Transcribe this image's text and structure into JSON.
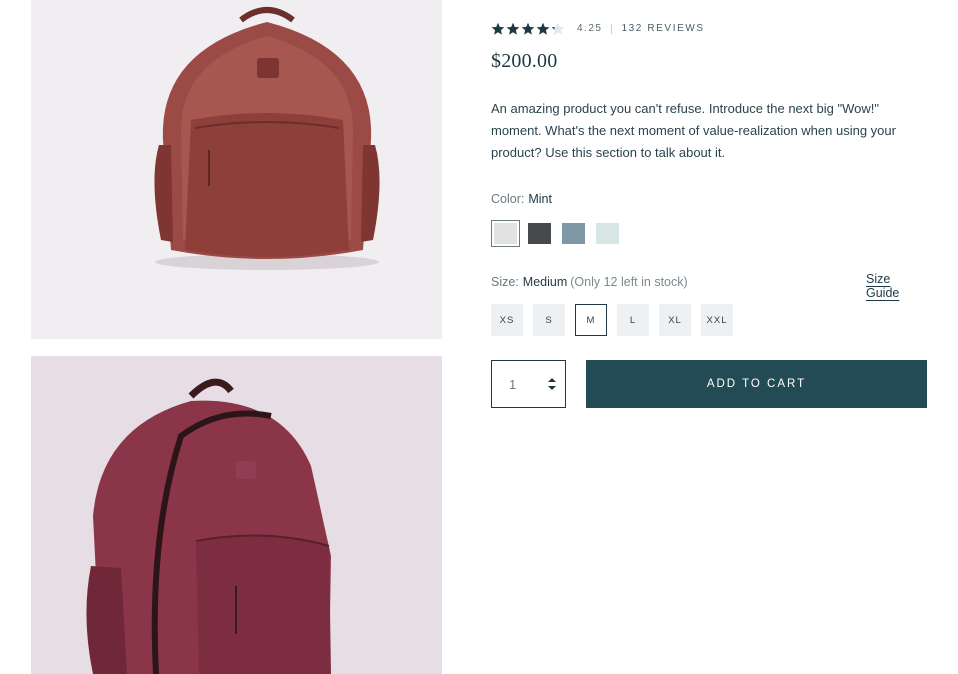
{
  "gallery": {
    "images": [
      {
        "name": "product-image-front",
        "alt": "Red leather backpack front view"
      },
      {
        "name": "product-image-angle",
        "alt": "Red leather backpack angled view"
      }
    ]
  },
  "product": {
    "rating": 4.25,
    "rating_text": "4.25",
    "review_count_text": "132 REVIEWS",
    "price": "$200.00",
    "description": "An amazing product you can't refuse. Introduce the next big \"Wow!\" moment. What's the next moment of value-realization when using your product? Use this section to talk about it."
  },
  "color": {
    "label": "Color:",
    "selected": "Mint",
    "swatches": [
      {
        "name": "light-gray",
        "hex": "#e2e2e2",
        "selected": true
      },
      {
        "name": "charcoal",
        "hex": "#474a4c",
        "selected": false
      },
      {
        "name": "slate-blue",
        "hex": "#7e98a6",
        "selected": false
      },
      {
        "name": "mint",
        "hex": "#d6e6e4",
        "selected": false
      }
    ]
  },
  "size": {
    "label": "Size:",
    "selected": "Medium",
    "stock_note": "(Only 12 left in stock)",
    "guide_label": "Size Guide",
    "options": [
      "XS",
      "S",
      "M",
      "L",
      "XL",
      "XXL"
    ],
    "selected_option": "M"
  },
  "cart": {
    "quantity": "1",
    "add_label": "ADD TO CART"
  },
  "colors": {
    "accent": "#234b56",
    "text_dark": "#1e3944",
    "star": "#1e3944"
  }
}
